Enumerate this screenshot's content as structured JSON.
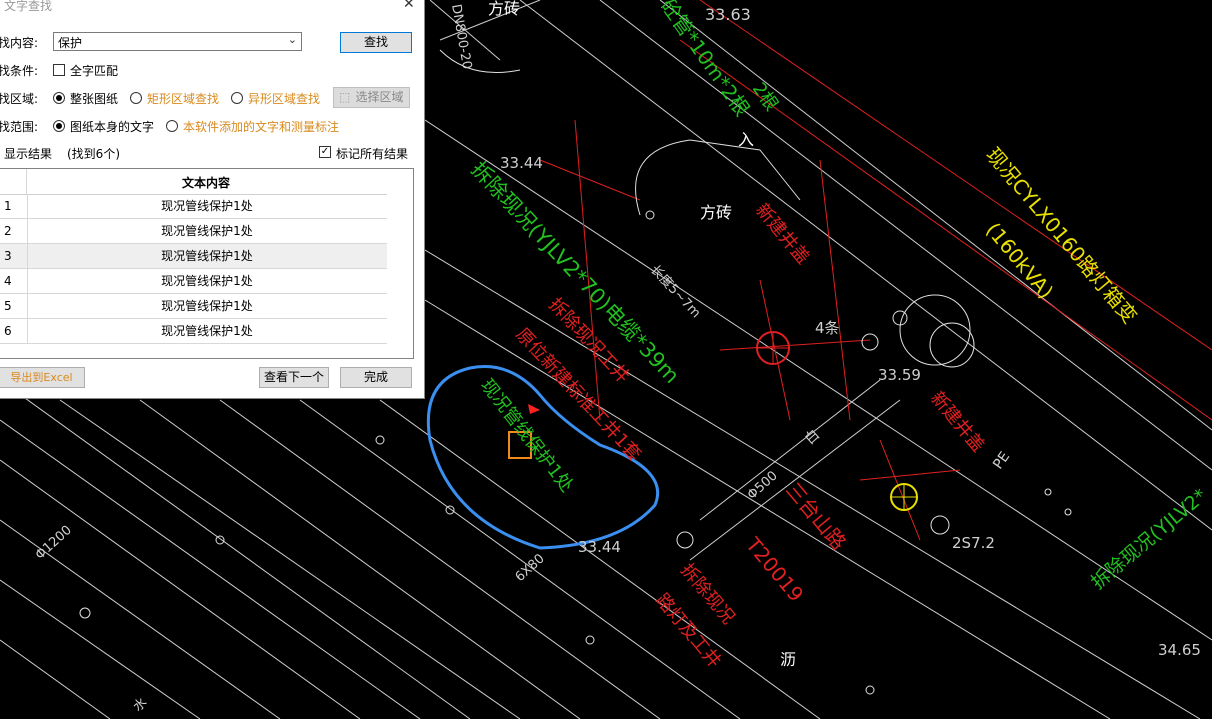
{
  "dialog": {
    "title": "文字查找",
    "close": "✕",
    "find_label": "找内容:",
    "find_value": "保护",
    "find_button": "查找",
    "cond_label": "找条件:",
    "whole_word": "全字匹配",
    "area_label": "找区域:",
    "area_whole": "整张图纸",
    "area_rect": "矩形区域查找",
    "area_irregular": "异形区域查找",
    "select_area_button": "选择区域",
    "scope_label": "找范围:",
    "scope_self": "图纸本身的文字",
    "scope_added": "本软件添加的文字和测量标注",
    "results_label": "显示结果",
    "results_count": "(找到6个)",
    "mark_all": "标记所有结果",
    "table_header": "文本内容",
    "rows": [
      {
        "n": "1",
        "text": "现况管线保护1处"
      },
      {
        "n": "2",
        "text": "现况管线保护1处"
      },
      {
        "n": "3",
        "text": "现况管线保护1处"
      },
      {
        "n": "4",
        "text": "现况管线保护1处"
      },
      {
        "n": "5",
        "text": "现况管线保护1处"
      },
      {
        "n": "6",
        "text": "现况管线保护1处"
      }
    ],
    "export_button": "导出到Excel",
    "next_button": "查看下一个",
    "done_button": "完成"
  },
  "cad": {
    "texts": {
      "t1": "方砖",
      "t2": "砼管*10m*2根",
      "t3": "33.63",
      "t4": "拆除现况(YJLV2*70)电缆*39m",
      "t5": "33.44",
      "t6": "方砖",
      "t7": "新建井盖",
      "t8": "现况CYLX0160路灯箱变",
      "t9": "(160kVA)",
      "t10": "拆除现况工井",
      "t11": "原位新建标准工井1套",
      "t12": "现况管线保护1处",
      "t13": "4条",
      "t14": "33.59",
      "t15": "新建井盖",
      "t16": "三台山路",
      "t17": "T20019",
      "t18": "拆除现况",
      "t19": "路灯及工井",
      "t20": "33.44",
      "t21": "拆除现况(YJLV2*",
      "t22": "34.65",
      "t23": "沥",
      "t24": "入",
      "t25": "Φ1200",
      "t26": "Φ500",
      "t27": "2S7.2",
      "t28": "PE",
      "t29": "长度5~7m",
      "t30": "DN800-20",
      "t31": "6X80",
      "t32": "2根",
      "t33": "白",
      "t34": "水"
    }
  }
}
